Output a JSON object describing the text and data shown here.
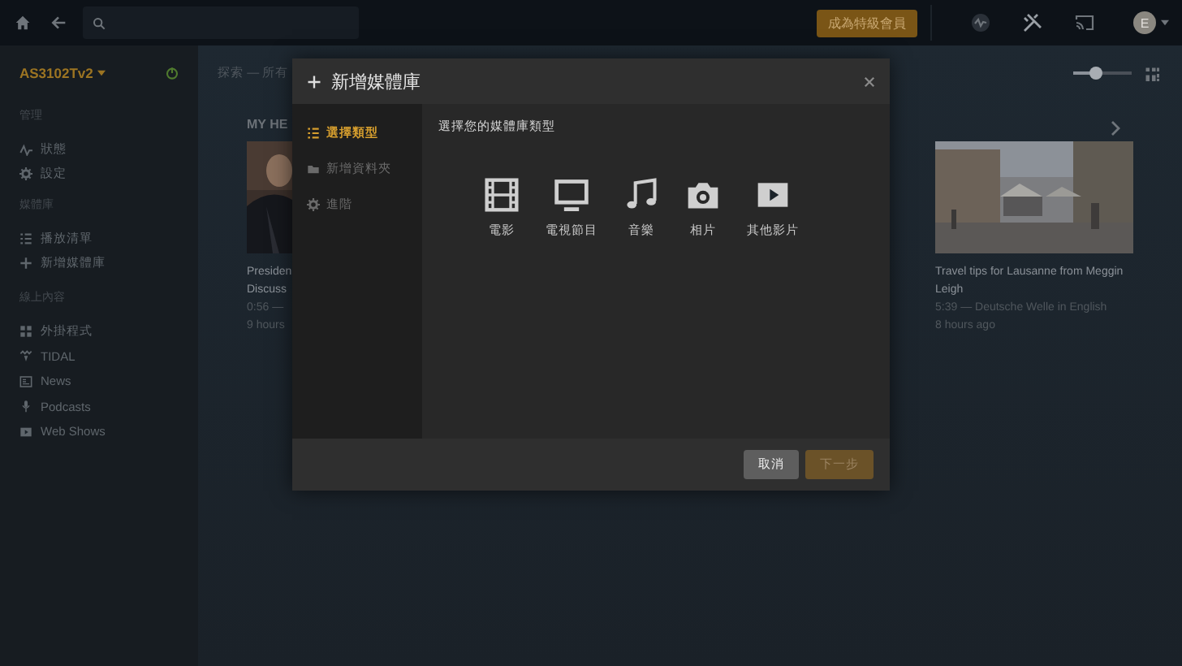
{
  "topbar": {
    "premium_button": "成為特級會員",
    "avatar": "E"
  },
  "sidebar": {
    "server": "AS3102Tv2",
    "sections": [
      {
        "heading": "管理",
        "items": [
          {
            "label": "狀態"
          },
          {
            "label": "設定"
          }
        ]
      },
      {
        "heading": "媒體庫",
        "items": [
          {
            "label": "播放清單"
          },
          {
            "label": "新增媒體庫"
          }
        ]
      },
      {
        "heading": "線上內容",
        "items": [
          {
            "label": "外掛程式"
          },
          {
            "label": "TIDAL"
          },
          {
            "label": "News"
          },
          {
            "label": "Podcasts"
          },
          {
            "label": "Web Shows"
          }
        ]
      }
    ]
  },
  "main": {
    "breadcrumb": "探索 — 所有",
    "zoom_slider": {
      "level": 0.4
    },
    "section_title": "MY HE",
    "cards": [
      {
        "lines": [
          "Presiden",
          "Discuss",
          "0:56 —",
          "9 hours"
        ]
      },
      {
        "lines": [
          "Travel tips for Lausanne from Meggin Leigh",
          "5:39 — Deutsche Welle in English",
          "8 hours ago"
        ]
      }
    ]
  },
  "dialog": {
    "title": "新增媒體庫",
    "steps": [
      {
        "label": "選擇類型",
        "selected": true,
        "disabled": false
      },
      {
        "label": "新增資料夾",
        "selected": false,
        "disabled": true
      },
      {
        "label": "進階",
        "selected": false,
        "disabled": true
      }
    ],
    "prompt": "選擇您的媒體庫類型",
    "types": [
      {
        "label": "電影"
      },
      {
        "label": "電視節目"
      },
      {
        "label": "音樂"
      },
      {
        "label": "相片"
      },
      {
        "label": "其他影片"
      }
    ],
    "buttons": [
      {
        "label": "取消",
        "kind": "cancel",
        "disabled": false
      },
      {
        "label": "下一步",
        "kind": "primary",
        "disabled": true
      }
    ]
  }
}
